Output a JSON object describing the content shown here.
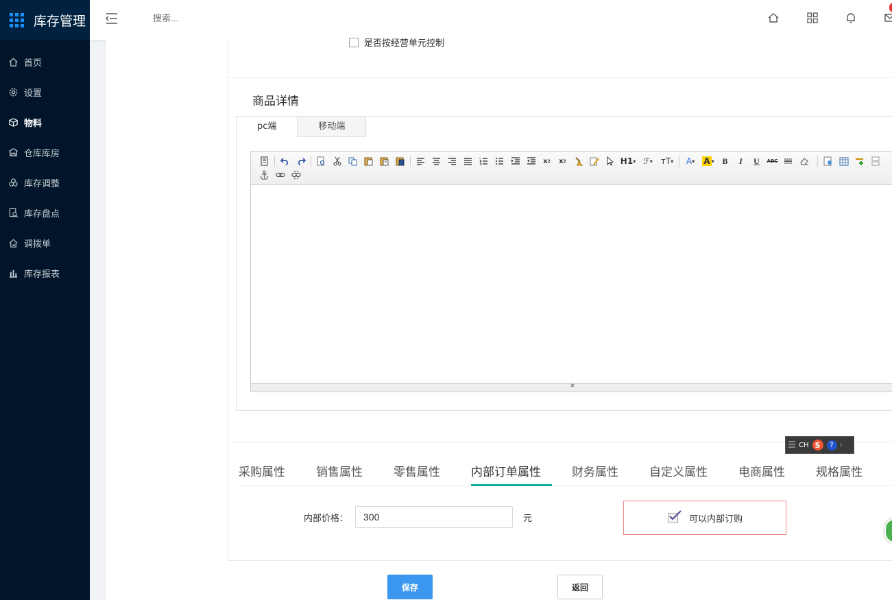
{
  "app": {
    "title": "库存管理"
  },
  "sidebar": {
    "items": [
      {
        "label": "首页",
        "icon": "home-icon"
      },
      {
        "label": "设置",
        "icon": "gear-icon"
      },
      {
        "label": "物料",
        "icon": "cube-icon",
        "active": true
      },
      {
        "label": "仓库库房",
        "icon": "warehouse-icon"
      },
      {
        "label": "库存调整",
        "icon": "adjust-icon"
      },
      {
        "label": "库存盘点",
        "icon": "inventory-check-icon"
      },
      {
        "label": "调拨单",
        "icon": "transfer-icon"
      },
      {
        "label": "库存报表",
        "icon": "bar-chart-icon"
      }
    ]
  },
  "topbar": {
    "search_placeholder": "搜索...",
    "icons": [
      "home-icon",
      "apps-icon",
      "bell-icon",
      "mail-icon"
    ]
  },
  "form": {
    "top_checkbox_label": "是否按经营单元控制",
    "detail_title": "商品详情",
    "editor_tabs": [
      "pc端",
      "移动端"
    ],
    "property_tabs": [
      "采购属性",
      "销售属性",
      "零售属性",
      "内部订单属性",
      "财务属性",
      "自定义属性",
      "电商属性",
      "规格属性"
    ],
    "active_property_tab": "内部订单属性",
    "internal_price_label": "内部价格：",
    "internal_price_value": "300",
    "unit": "元",
    "internal_order_checkbox_label": "可以内部订购",
    "internal_order_checked": true
  },
  "editor": {
    "toolbar_text": {
      "h1": "H1",
      "font": "ℱ",
      "size": "тT",
      "bold": "B",
      "italic": "I",
      "underline": "U",
      "strike": "ABC"
    }
  },
  "ime": {
    "label": "CH",
    "s": "S",
    "help": "?"
  },
  "actions": {
    "save_label": "保存",
    "back_label": "返回"
  },
  "colors": {
    "sidebar": "#001529",
    "accent": "#13ae96",
    "primary": "#3b97ef",
    "highlight_border": "#e88888"
  }
}
